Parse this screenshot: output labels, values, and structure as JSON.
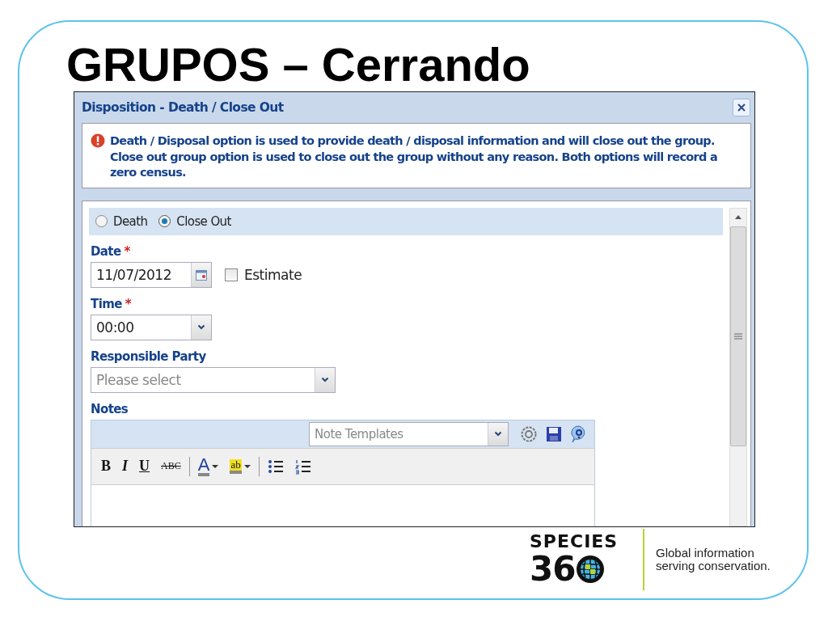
{
  "slide": {
    "title": "GRUPOS – Cerrando"
  },
  "dialog": {
    "title": "Disposition - Death / Close Out",
    "message": "Death / Disposal option is used to provide death / disposal information and will close out the group. Close out group option is used to close out the group without any reason. Both options will record a zero census.",
    "options": [
      {
        "label": "Death",
        "selected": false
      },
      {
        "label": "Close Out",
        "selected": true
      }
    ],
    "date": {
      "label": "Date",
      "required_mark": "*",
      "value": "11/07/2012"
    },
    "estimate": {
      "label": "Estimate",
      "checked": false
    },
    "time": {
      "label": "Time",
      "required_mark": "*",
      "value": "00:00"
    },
    "responsible_party": {
      "label": "Responsible Party",
      "placeholder": "Please select"
    },
    "notes": {
      "label": "Notes",
      "templates_placeholder": "Note Templates",
      "toolbar": [
        {
          "kind": "bold",
          "label": "B"
        },
        {
          "kind": "italic",
          "label": "I"
        },
        {
          "kind": "underline",
          "label": "U"
        },
        {
          "kind": "strike",
          "label": "ABC"
        },
        {
          "kind": "separator"
        },
        {
          "kind": "font-color",
          "label": "A"
        },
        {
          "kind": "highlight",
          "label": "ab"
        },
        {
          "kind": "separator"
        },
        {
          "kind": "bullets"
        },
        {
          "kind": "numbering"
        }
      ]
    }
  },
  "logo": {
    "wordmark": "SPECIES",
    "number": "36",
    "tagline": "Global information serving conservation."
  }
}
